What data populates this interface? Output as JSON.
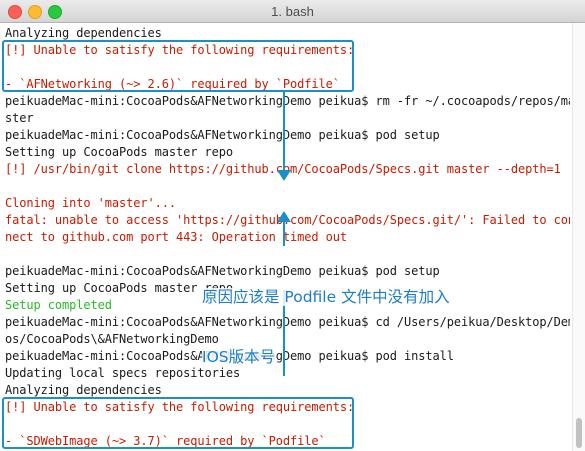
{
  "window": {
    "title": "1. bash"
  },
  "terminal": {
    "lines": [
      {
        "text": "Analyzing dependencies",
        "style": "normal"
      },
      {
        "text": "[!] Unable to satisfy the following requirements:",
        "style": "red"
      },
      {
        "text": "",
        "style": "normal"
      },
      {
        "text": "- `AFNetworking (~> 2.6)` required by `Podfile`",
        "style": "red"
      },
      {
        "text": "peikuadeMac-mini:CocoaPods&AFNetworkingDemo peikua$ rm -fr ~/.cocoapods/repos/ma",
        "style": "normal"
      },
      {
        "text": "ster",
        "style": "normal"
      },
      {
        "text": "peikuadeMac-mini:CocoaPods&AFNetworkingDemo peikua$ pod setup",
        "style": "normal"
      },
      {
        "text": "Setting up CocoaPods master repo",
        "style": "normal"
      },
      {
        "text": "[!] /usr/bin/git clone https://github.com/CocoaPods/Specs.git master --depth=1",
        "style": "red"
      },
      {
        "text": "",
        "style": "normal"
      },
      {
        "text": "Cloning into 'master'...",
        "style": "red"
      },
      {
        "text": "fatal: unable to access 'https://github.com/CocoaPods/Specs.git/': Failed to con",
        "style": "red"
      },
      {
        "text": "nect to github.com port 443: Operation timed out",
        "style": "red"
      },
      {
        "text": "",
        "style": "normal"
      },
      {
        "text": "peikuadeMac-mini:CocoaPods&AFNetworkingDemo peikua$ pod setup",
        "style": "normal"
      },
      {
        "text": "Setting up CocoaPods master repo",
        "style": "normal"
      },
      {
        "text": "Setup completed",
        "style": "green"
      },
      {
        "text": "peikuadeMac-mini:CocoaPods&AFNetworkingDemo peikua$ cd /Users/peikua/Desktop/Dem",
        "style": "normal"
      },
      {
        "text": "os/CocoaPods\\&AFNetworkingDemo",
        "style": "normal"
      },
      {
        "text": "peikuadeMac-mini:CocoaPods&AFNetworkingDemo peikua$ pod install",
        "style": "normal"
      },
      {
        "text": "Updating local specs repositories",
        "style": "normal"
      },
      {
        "text": "Analyzing dependencies",
        "style": "normal"
      },
      {
        "text": "[!] Unable to satisfy the following requirements:",
        "style": "red"
      },
      {
        "text": "",
        "style": "normal"
      },
      {
        "text": "- `SDWebImage (~> 3.7)` required by `Podfile`",
        "style": "red"
      }
    ]
  },
  "annotation": {
    "line1": "原因应该是 Podfile 文件中没有加入",
    "line2": "IOS版本号"
  },
  "colors": {
    "accent": "#1a8fc8",
    "error": "#c91b00",
    "success": "#25bc24"
  }
}
